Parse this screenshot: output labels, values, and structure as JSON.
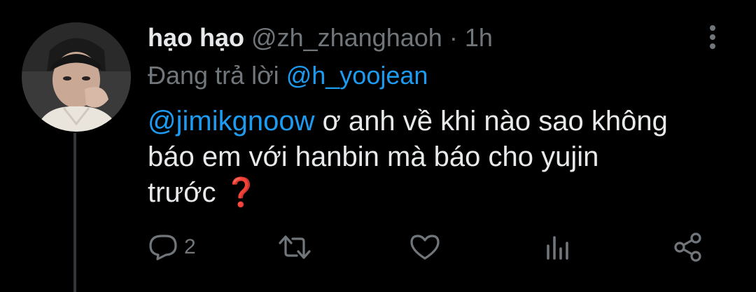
{
  "tweet": {
    "display_name": "hạo hạo",
    "handle": "@zh_zhanghaoh",
    "separator": "·",
    "time": "1h",
    "replying_prefix": "Đang trả lời",
    "replying_to": "@h_yoojean",
    "mention": "@jimikgnoow",
    "text_line1": " ơ anh về khi nào sao không",
    "text_line2": "báo em với hanbin mà báo cho yujin",
    "text_line3": "trước ",
    "emoji": "❓"
  },
  "actions": {
    "reply_count": "2"
  },
  "icons": {
    "more": "more-vertical-icon",
    "reply": "reply-icon",
    "retweet": "retweet-icon",
    "like": "heart-icon",
    "views": "analytics-icon",
    "share": "share-icon"
  },
  "colors": {
    "background": "#000000",
    "text": "#e7e9ea",
    "muted": "#71767b",
    "link": "#1d9bf0",
    "emoji": "#e0245e"
  }
}
